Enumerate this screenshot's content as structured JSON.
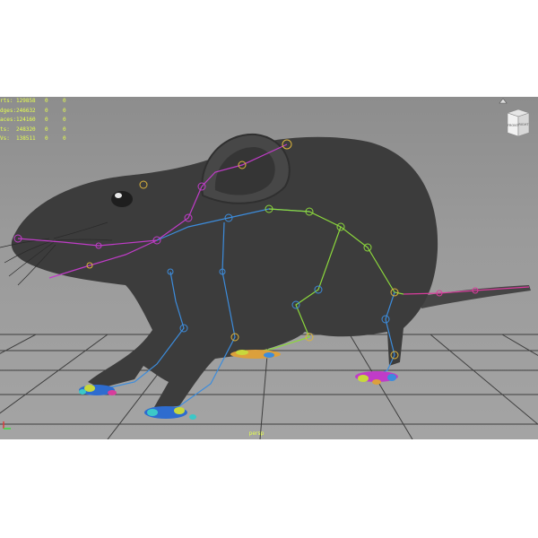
{
  "hud": {
    "rows": [
      {
        "label": "rts:",
        "count": "129858",
        "a": "0",
        "b": "0"
      },
      {
        "label": "dges:",
        "count": "246632",
        "a": "0",
        "b": "0"
      },
      {
        "label": "aces:",
        "count": "124160",
        "a": "0",
        "b": "0"
      },
      {
        "label": "ts:",
        "count": "248320",
        "a": "0",
        "b": "0"
      },
      {
        "label": "Vs:",
        "count": "138511",
        "a": "0",
        "b": "0"
      }
    ],
    "color": "#e6ff4e"
  },
  "viewcube": {
    "front_label": "FRONT",
    "right_label": "RIGHT"
  },
  "camera_label": "persp",
  "colors": {
    "viewport_bg": "#9a9a9a",
    "grid": "#4a4a4a",
    "mesh": "#3c3c3c",
    "bone_head": "#c03cc8",
    "bone_spine": "#3c8cdc",
    "bone_back": "#8cd83c",
    "bone_tail": "#d83c9c"
  }
}
